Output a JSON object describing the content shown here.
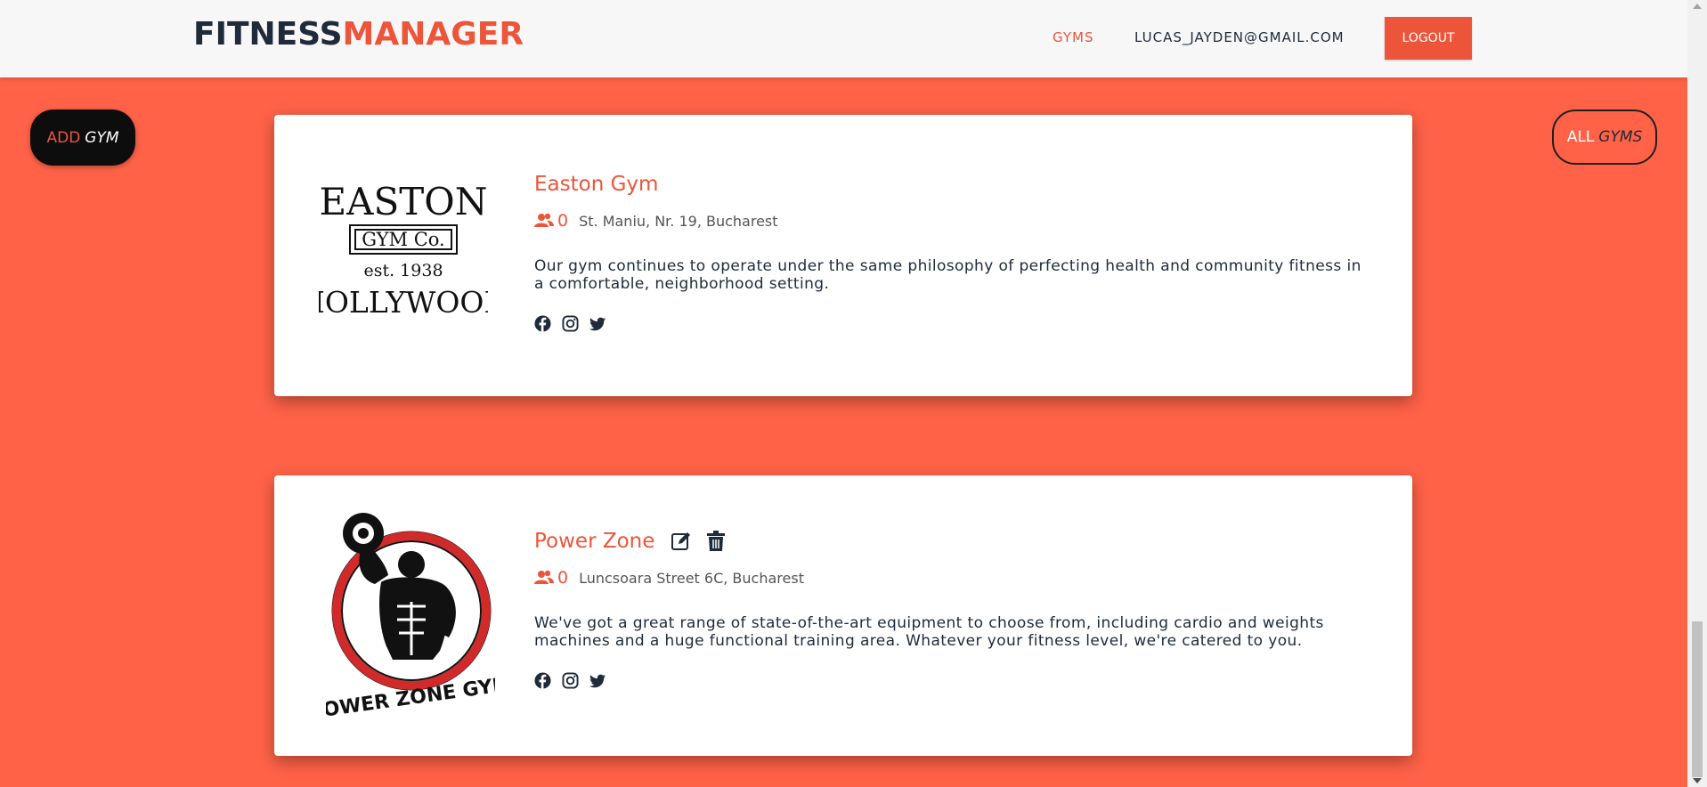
{
  "brand": {
    "part1": "FITNESS",
    "part2": "MANAGER"
  },
  "nav": {
    "gyms": "GYMS",
    "user_email": "LUCAS_JAYDEN@GMAIL.COM",
    "logout": "LOGOUT"
  },
  "actions": {
    "add_gym": {
      "w1": "ADD",
      "w2": "GYM"
    },
    "all_gyms": {
      "w1": "ALL",
      "w2": "GYMS"
    }
  },
  "gyms": [
    {
      "name": "Easton Gym",
      "members": "0",
      "address": "St. Maniu, Nr. 19, Bucharest",
      "description": "Our gym continues to operate under the same philosophy of perfecting health and community fitness in a comfortable, neighborhood setting.",
      "logo": {
        "line1": "EASTON",
        "line2": "GYM Co.",
        "line3": "est. 1938",
        "line4": "HOLLYWOOD"
      }
    },
    {
      "name": "Power Zone",
      "members": "0",
      "address": "Luncsoara Street 6C, Bucharest",
      "description": "We've got a great range of state-of-the-art equipment to choose from, including cardio and weights machines and a huge functional training area. Whatever your fitness level, we're catered to you.",
      "logo": {
        "text": "POWER ZONE GYM"
      }
    }
  ],
  "icons": [
    "members-icon",
    "edit-icon",
    "trash-icon",
    "facebook-icon",
    "instagram-icon",
    "twitter-icon"
  ],
  "colors": {
    "accent": "#ec553a",
    "background": "#ff6247",
    "dark": "#1f2a3a"
  }
}
